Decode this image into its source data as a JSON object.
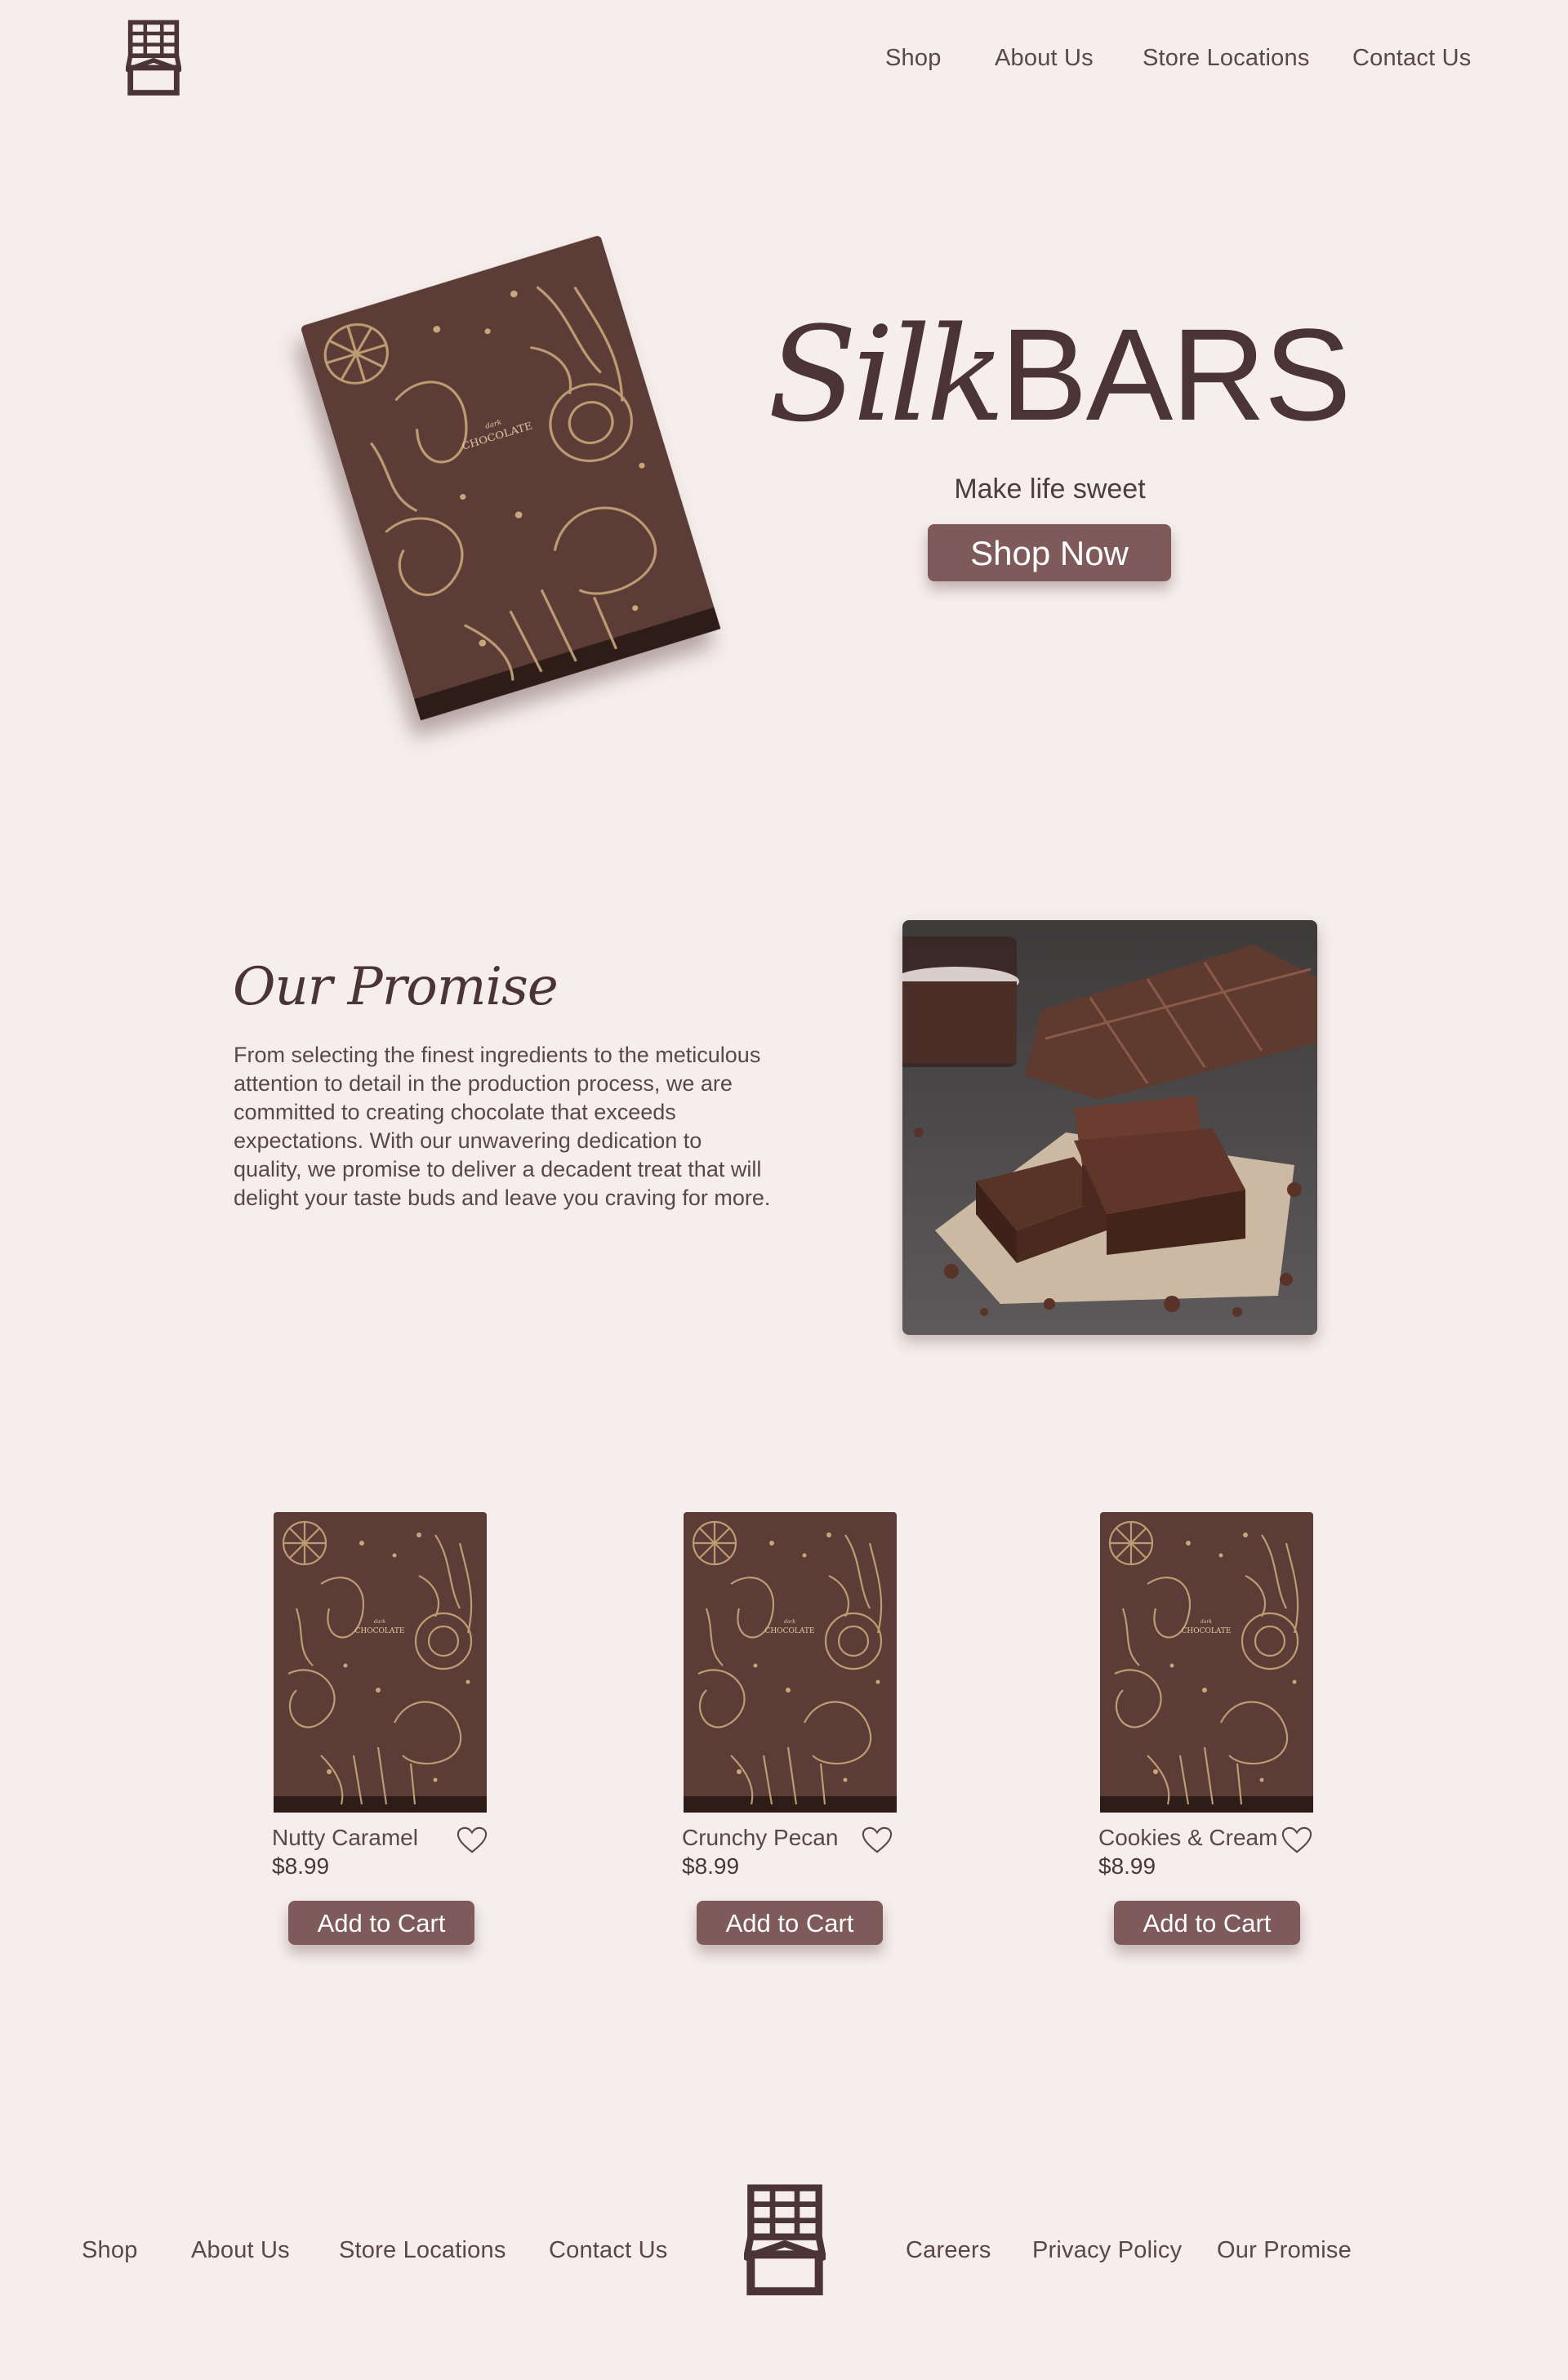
{
  "header": {
    "logo_icon": "chocolate-bar-icon",
    "nav": [
      "Shop",
      "About Us",
      "Store Locations",
      "Contact Us"
    ]
  },
  "hero": {
    "title_script": "Silk",
    "title_caps": "BARS",
    "tagline": "Make life sweet",
    "cta_label": "Shop Now"
  },
  "promise": {
    "title": "Our Promise",
    "body": "From selecting the finest ingredients to the meticulous attention to detail in the production process, we are committed to creating chocolate that exceeds expectations. With our unwavering dedication to quality, we promise to deliver a decadent treat that will delight your taste buds and leave you craving for more."
  },
  "products": [
    {
      "name": "Nutty Caramel",
      "price": "$8.99",
      "cart_label": "Add to Cart",
      "icon": "heart-icon"
    },
    {
      "name": "Crunchy Pecan",
      "price": "$8.99",
      "cart_label": "Add to Cart",
      "icon": "heart-icon"
    },
    {
      "name": "Cookies & Cream",
      "price": "$8.99",
      "cart_label": "Add to Cart",
      "icon": "heart-icon"
    }
  ],
  "footer": {
    "nav_left": [
      "Shop",
      "About Us",
      "Store Locations",
      "Contact Us"
    ],
    "nav_right": [
      "Careers",
      "Privacy Policy",
      "Our Promise"
    ],
    "logo_icon": "chocolate-bar-icon"
  },
  "colors": {
    "background": "#f6eeec",
    "brand_dark": "#4b3434",
    "button": "#7e5a5a",
    "chocolate": "#5a3a35",
    "gold": "#c9a77a"
  }
}
